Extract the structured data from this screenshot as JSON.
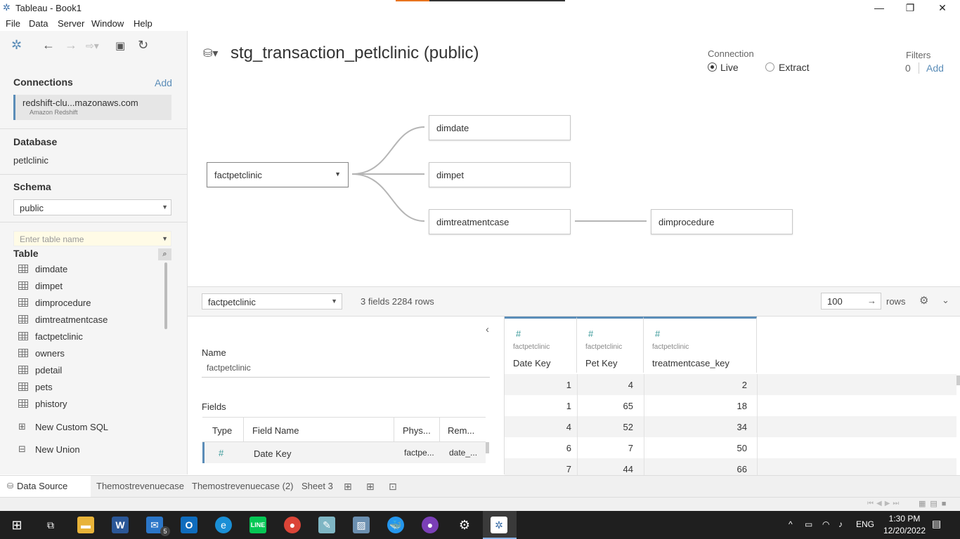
{
  "window": {
    "title": "Tableau - Book1"
  },
  "menu": [
    "File",
    "Data",
    "Server",
    "Window",
    "Help"
  ],
  "left": {
    "connections_title": "Connections",
    "add_label": "Add",
    "connection": {
      "name": "redshift-clu...mazonaws.com",
      "type": "Amazon Redshift"
    },
    "database_title": "Database",
    "database_value": "petlclinic",
    "schema_title": "Schema",
    "schema_value": "public",
    "table_search_placeholder": "Enter table name",
    "table_title": "Table",
    "tables": [
      "dimdate",
      "dimpet",
      "dimprocedure",
      "dimtreatmentcase",
      "factpetclinic",
      "owners",
      "pdetail",
      "pets",
      "phistory"
    ],
    "new_custom_sql": "New Custom SQL",
    "new_union": "New Union"
  },
  "canvas": {
    "datasource_title": "stg_transaction_petlclinic (public)",
    "connection_label": "Connection",
    "live_label": "Live",
    "extract_label": "Extract",
    "connection_mode": "live",
    "filters_label": "Filters",
    "filters_count": "0",
    "filters_add": "Add",
    "root_table": "factpetclinic",
    "joined_tables": [
      "dimdate",
      "dimpet",
      "dimtreatmentcase"
    ],
    "second_level_table": "dimprocedure"
  },
  "gridbar": {
    "table_select": "factpetclinic",
    "summary": "3 fields 2284 rows",
    "rows_value": "100",
    "rows_label": "rows"
  },
  "meta": {
    "name_label": "Name",
    "name_value": "factpetclinic",
    "fields_label": "Fields",
    "headers": [
      "Type",
      "Field Name",
      "Phys...",
      "Rem..."
    ],
    "row": {
      "type_icon": "#",
      "field_name": "Date Key",
      "physical": "factpe...",
      "remote": "date_..."
    }
  },
  "grid": {
    "columns": [
      {
        "source": "factpetclinic",
        "name": "Date Key"
      },
      {
        "source": "factpetclinic",
        "name": "Pet Key"
      },
      {
        "source": "factpetclinic",
        "name": "treatmentcase_key"
      }
    ],
    "rows": [
      [
        "1",
        "4",
        "2"
      ],
      [
        "1",
        "65",
        "18"
      ],
      [
        "4",
        "52",
        "34"
      ],
      [
        "6",
        "7",
        "50"
      ],
      [
        "7",
        "44",
        "66"
      ]
    ]
  },
  "tabs": [
    "Data Source",
    "Themostrevenuecase",
    "Themostrevenuecase (2)",
    "Sheet 3"
  ],
  "taskbar": {
    "lang": "ENG",
    "time": "1:30 PM",
    "date": "12/20/2022",
    "mail_badge": "5"
  },
  "colors": {
    "accent": "#5b8db8",
    "field_icon": "#3b9a9a",
    "taskbar": "#1f1f1f"
  }
}
